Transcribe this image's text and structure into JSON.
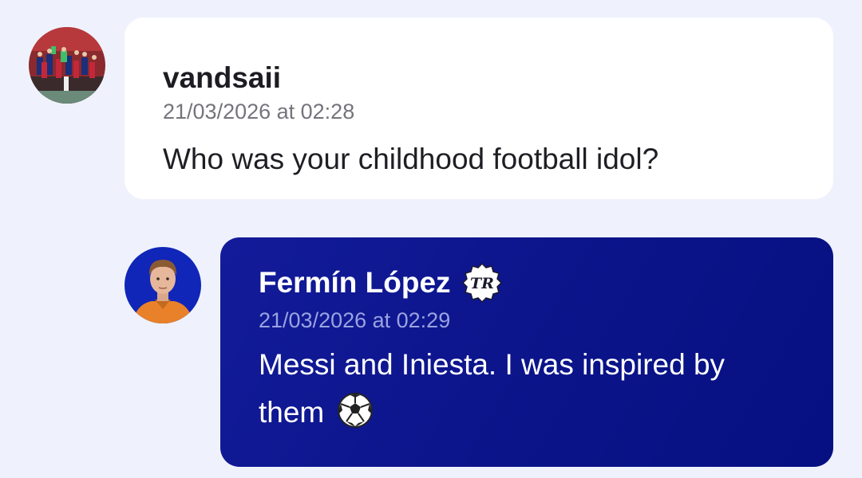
{
  "messages": [
    {
      "author": "vandsaii",
      "timestamp": "21/03/2026 at 02:28",
      "text": "Who was your childhood football idol?",
      "avatar_icon": "team-photo-avatar"
    },
    {
      "author": "Fermín López",
      "timestamp": "21/03/2026 at 02:29",
      "text": "Messi and Iniesta. I was inspired by them",
      "badge_icon": "verified-tr-badge-icon",
      "emoji_icon": "soccer-ball-icon",
      "avatar_icon": "player-portrait-avatar"
    }
  ],
  "colors": {
    "page_background": "#eff2fc",
    "incoming_card": "#ffffff",
    "outgoing_card": "#0b1489"
  }
}
